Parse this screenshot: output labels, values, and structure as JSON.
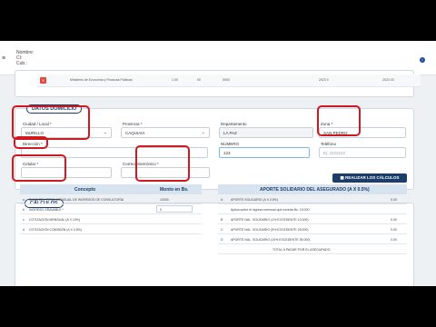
{
  "header": {
    "menu_glyph": "≡",
    "user_label_1": "Nombre:",
    "user_label_2": "CI:",
    "user_label_3": "Cub.:",
    "info_glyph": "i"
  },
  "top_row": {
    "delete_glyph": "✕",
    "description": "Ministerio de Economía y Finanzas Públicas",
    "code1": "1.00",
    "code2": "00",
    "code3": "5000",
    "date1": "2023 0",
    "date2": "2023 03"
  },
  "domicilio": {
    "legend": "DATOS DOMICILIO",
    "ciudad_label": "Ciudad / Local *",
    "ciudad_value": "MURILLO",
    "provincia_label": "Provincia *",
    "provincia_value": "CAQUIAVI",
    "departamento_label": "Departamento",
    "departamento_value": "LA PAZ",
    "zona_label": "Zona *",
    "zona_value": "SAN PEDRO",
    "direccion_label": "Dirección *",
    "direccion_value": "",
    "numero_label": "NÚMERO",
    "numero_value": "123",
    "telefono_label": "Teléfono",
    "telefono_placeholder": "Ej: 2222222",
    "celular_label": "Celular *",
    "correo_label": "Correo electrónico *"
  },
  "calculos": {
    "legend": "CÁLCULOS",
    "button_label": "REALIZAR LOS CÁLCULOS",
    "left_table": {
      "col_concepto": "Concepto",
      "col_monto": "Monto en Bs.",
      "rows": [
        {
          "n": "a",
          "concepto": "SUMA DEL TOTAL MENSUAL DE INGRESOS DE CONSULTORÍA",
          "monto": "10000"
        },
        {
          "n": "b",
          "concepto": "INGRESO GRAVABLE *",
          "monto": "0"
        },
        {
          "n": "c",
          "concepto": "COTIZACIÓN MENSUAL (A X 10%)",
          "monto": ""
        },
        {
          "n": "d",
          "concepto": "COTIZACIÓN COMISIÓN (A X 0.5%)",
          "monto": ""
        }
      ]
    },
    "right_table": {
      "title": "APORTE SOLIDARIO DEL ASEGURADO (A X 0.5%)",
      "rows": [
        {
          "n": "A",
          "concepto": "APORTE SOLIDARIO (A X 0.5%)",
          "monto": "0.00"
        },
        {
          "n": "",
          "concepto": "Aplica sobre el ingreso mensual que exceda Bs. 13.000",
          "monto": ""
        },
        {
          "n": "B",
          "concepto": "APORTE NAL. SOLIDARIO (1% EXCEDENTE 13.000)",
          "monto": "0.00"
        },
        {
          "n": "C",
          "concepto": "APORTE NAL. SOLIDARIO (5% EXCEDENTE 25.000)",
          "monto": "0.00"
        },
        {
          "n": "D",
          "concepto": "APORTE NAL. SOLIDARIO (10% EXCEDENTE 35.000)",
          "monto": "0.00"
        },
        {
          "n": "",
          "concepto": "TOTAL A PAGAR POR EL ASEGURADO",
          "monto": ""
        }
      ]
    }
  }
}
